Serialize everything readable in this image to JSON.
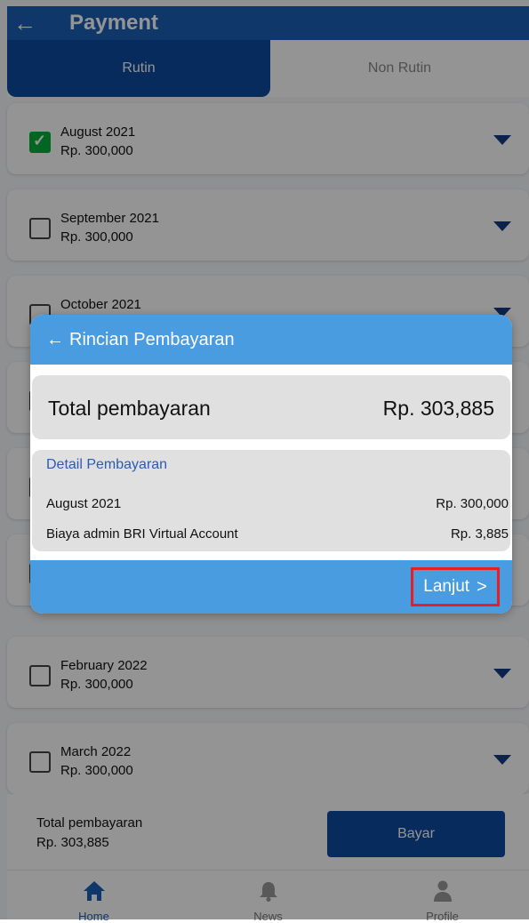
{
  "header": {
    "title": "Payment",
    "back_icon": "arrow-left-icon"
  },
  "tabs": [
    {
      "label": "Rutin",
      "active": true
    },
    {
      "label": "Non Rutin",
      "active": false
    }
  ],
  "months": [
    {
      "month": "August 2021",
      "amount": "Rp. 300,000",
      "checked": true
    },
    {
      "month": "September 2021",
      "amount": "Rp. 300,000",
      "checked": false
    },
    {
      "month": "October 2021",
      "amount": "",
      "checked": false
    },
    {
      "month": "",
      "amount": "",
      "checked": false
    },
    {
      "month": "",
      "amount": "",
      "checked": false
    },
    {
      "month": "",
      "amount": "",
      "checked": false
    },
    {
      "month": "February 2022",
      "amount": "Rp. 300,000",
      "checked": false
    },
    {
      "month": "March 2022",
      "amount": "Rp. 300,000",
      "checked": false
    }
  ],
  "footer": {
    "total_label": "Total pembayaran",
    "total_value": "Rp. 303,885",
    "pay_button": "Bayar"
  },
  "nav": [
    {
      "label": "Home",
      "icon": "home-icon",
      "active": true
    },
    {
      "label": "News",
      "icon": "bell-icon",
      "active": false
    },
    {
      "label": "Profile",
      "icon": "person-icon",
      "active": false
    }
  ],
  "modal": {
    "title": "Rincian Pembayaran",
    "total_label": "Total pembayaran",
    "total_value": "Rp. 303,885",
    "detail_title": "Detail Pembayaran",
    "items": [
      {
        "label": "August 2021",
        "value": "Rp. 300,000"
      },
      {
        "label": "Biaya admin BRI Virtual Account",
        "value": "Rp. 3,885"
      }
    ],
    "next_button": "Lanjut",
    "next_icon": "chevron-right-icon"
  },
  "colors": {
    "header_bg": "#1d5fb6",
    "tab_active_bg": "#0e4aa0",
    "modal_header_bg": "#4a9ce0",
    "checkbox_checked": "#00b03c",
    "highlight_border": "#e51f24"
  }
}
